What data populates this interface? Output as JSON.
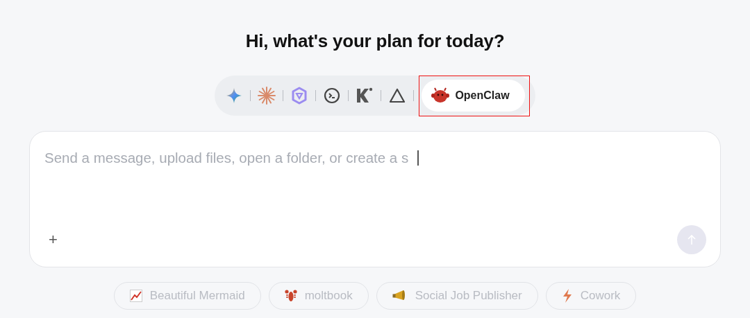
{
  "heading": "Hi, what's your plan for today?",
  "agents": [
    {
      "kind": "sparkle",
      "selected": false
    },
    {
      "kind": "burst",
      "selected": false
    },
    {
      "kind": "hexagon",
      "selected": false
    },
    {
      "kind": "terminal",
      "selected": false
    },
    {
      "kind": "k",
      "selected": false
    },
    {
      "kind": "triangle",
      "selected": false
    },
    {
      "kind": "critter",
      "label": "OpenClaw",
      "selected": true
    }
  ],
  "composer": {
    "placeholder": "Send a message, upload files, open a folder, or create a s",
    "add_label": "+"
  },
  "suggestions": [
    {
      "kind": "chart",
      "label": "Beautiful Mermaid"
    },
    {
      "kind": "lobster",
      "label": "moltbook"
    },
    {
      "kind": "megaphone",
      "label": "Social Job Publisher"
    },
    {
      "kind": "bolt",
      "label": "Cowork"
    }
  ]
}
